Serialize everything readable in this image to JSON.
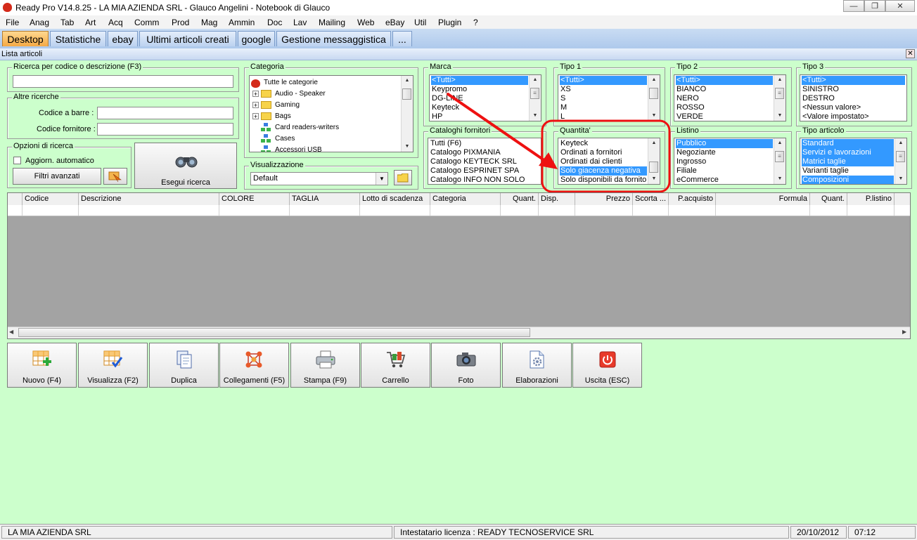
{
  "window": {
    "title": "Ready Pro V14.8.25 - LA MIA AZIENDA SRL - Glauco Angelini - Notebook di Glauco"
  },
  "menu": [
    "File",
    "Anag",
    "Tab",
    "Art",
    "Acq",
    "Comm",
    "Prod",
    "Mag",
    "Ammin",
    "Doc",
    "Lav",
    "Mailing",
    "Web",
    "eBay",
    "Util",
    "Plugin",
    "?"
  ],
  "tabs": [
    "Desktop",
    "Statistiche",
    "ebay",
    "Ultimi articoli creati",
    "google",
    "Gestione messaggistica",
    "..."
  ],
  "subwindow": {
    "title": "Lista articoli"
  },
  "search": {
    "code_group": "Ricerca per codice o descrizione (F3)",
    "code_value": "",
    "other_group": "Altre ricerche",
    "barcode_label": "Codice a barre :",
    "barcode_value": "",
    "supplier_code_label": "Codice fornitore :",
    "supplier_code_value": "",
    "options_group": "Opzioni di ricerca",
    "auto_update_label": "Aggiorn. automatico",
    "advanced_filters": "Filtri avanzati",
    "run_search": "Esegui ricerca"
  },
  "category": {
    "legend": "Categoria",
    "items": [
      "Tutte le categorie",
      "Audio - Speaker",
      "Gaming",
      "Bags",
      "Card readers-writers",
      "Cases",
      "Accessori USB"
    ]
  },
  "view": {
    "legend": "Visualizzazione",
    "value": "Default"
  },
  "marca": {
    "legend": "Marca",
    "items": [
      "<Tutti>",
      "Keypromo",
      "DG-LINE",
      "Keyteck",
      "HP"
    ]
  },
  "tipo1": {
    "legend": "Tipo 1",
    "items": [
      "<Tutti>",
      "XS",
      "S",
      "M",
      "L"
    ]
  },
  "tipo2": {
    "legend": "Tipo 2",
    "items": [
      "<Tutti>",
      "BIANCO",
      "NERO",
      "ROSSO",
      "VERDE"
    ]
  },
  "tipo3": {
    "legend": "Tipo 3",
    "items": [
      "<Tutti>",
      "SINISTRO",
      "DESTRO",
      "<Nessun valore>",
      "<Valore impostato>"
    ]
  },
  "cataloghi": {
    "legend": "Cataloghi fornitori",
    "items": [
      "Tutti (F6)",
      "Catalogo PIXMANIA",
      "Catalogo KEYTECK SRL",
      "Catalogo ESPRINET SPA",
      "Catalogo INFO NON SOLO"
    ]
  },
  "quantita": {
    "legend": "Quantita'",
    "items": [
      "Keyteck",
      "Ordinati a fornitori",
      "Ordinati dai clienti",
      "Solo giacenza negativa",
      "Solo disponibili da fornitore"
    ]
  },
  "listino": {
    "legend": "Listino",
    "items": [
      "Pubblico",
      "Negoziante",
      "Ingrosso",
      "Filiale",
      "eCommerce"
    ]
  },
  "tipo_articolo": {
    "legend": "Tipo articolo",
    "items": [
      "Standard",
      "Servizi e lavorazioni",
      "Matrici taglie",
      "Varianti taglie",
      "Composizioni"
    ]
  },
  "table": {
    "columns": [
      "",
      "Codice",
      "Descrizione",
      "COLORE",
      "TAGLIA",
      "Lotto di scadenza",
      "Categoria",
      "Quant.",
      "Disp.",
      "Prezzo",
      "Scorta ...",
      "P.acquisto",
      "Formula",
      "Quant.",
      "P.listino"
    ]
  },
  "toolbar": [
    "Nuovo (F4)",
    "Visualizza (F2)",
    "Duplica",
    "Collegamenti (F5)",
    "Stampa (F9)",
    "Carrello",
    "Foto",
    "Elaborazioni",
    "Uscita (ESC)"
  ],
  "status": {
    "company": "LA MIA AZIENDA SRL",
    "license": "Intestatario licenza : READY TECNOSERVICE SRL",
    "date": "20/10/2012",
    "time": "07:12"
  },
  "colors": {
    "selection": "#3399ff",
    "annotation": "#ee1111",
    "background": "#ccffcc",
    "active_tab": "#f5a944"
  }
}
